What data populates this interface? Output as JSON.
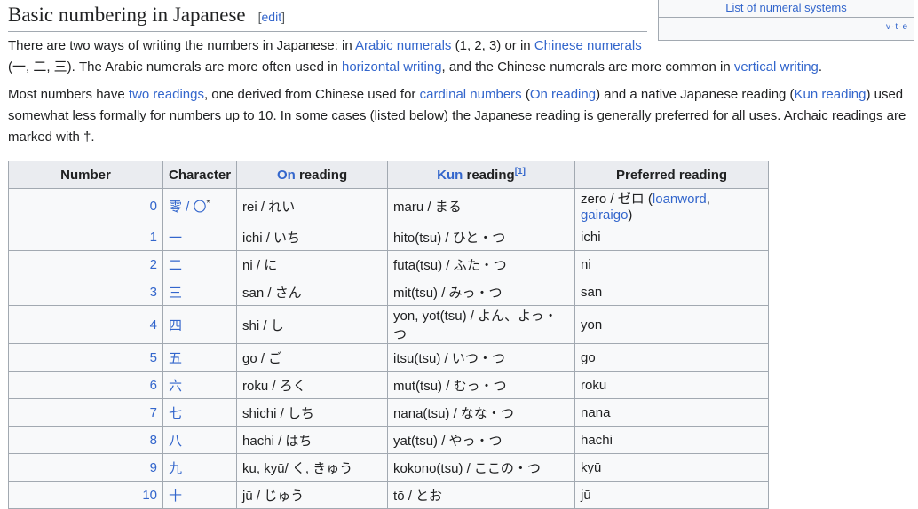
{
  "navbox": {
    "title": "List of numeral systems",
    "vte": "v·t·e"
  },
  "heading": {
    "title": "Basic numbering in Japanese",
    "edit_open": "[",
    "edit_label": "edit",
    "edit_close": "]"
  },
  "p1": {
    "t1": "There are two ways of writing the numbers in Japanese: in ",
    "l1": "Arabic numerals",
    "t2": " (1, 2, 3) or in ",
    "l2": "Chinese numerals",
    "t3": "(一, 二, 三). The Arabic numerals are more often used in ",
    "l3": "horizontal writing",
    "t4": ", and the Chinese numerals are more common in ",
    "l4": "vertical writing",
    "t5": "."
  },
  "p2": {
    "t1": "Most numbers have ",
    "l1": "two readings",
    "t2": ", one derived from Chinese used for ",
    "l2": "cardinal numbers",
    "t3": " (",
    "l3": "On reading",
    "t4": ") and a native Japanese reading (",
    "l4": "Kun reading",
    "t5": ") used somewhat less formally for numbers up to 10. In some cases (listed below) the Japanese reading is generally preferred for all uses. Archaic readings are marked with †."
  },
  "table": {
    "headers": {
      "number": "Number",
      "character": "Character",
      "on_link": "On",
      "on_rest": " reading",
      "kun_link": "Kun",
      "kun_rest": " reading",
      "kun_ref": "[1]",
      "preferred": "Preferred reading"
    },
    "rows": [
      {
        "number": "0",
        "character": "零 / 〇",
        "char_sup": "*",
        "on": "rei / れい",
        "kun": "maru / まる",
        "pref": "zero / ゼロ (",
        "pref_l1": "loanword",
        "pref_sep": ", ",
        "pref_l2": "gairaigo",
        "pref_end": ")"
      },
      {
        "number": "1",
        "character": "一",
        "on": "ichi / いち",
        "kun": "hito(tsu) / ひと・つ",
        "pref": "ichi"
      },
      {
        "number": "2",
        "character": "二",
        "on": "ni / に",
        "kun": "futa(tsu) / ふた・つ",
        "pref": "ni"
      },
      {
        "number": "3",
        "character": "三",
        "on": "san / さん",
        "kun": "mit(tsu) / みっ・つ",
        "pref": "san"
      },
      {
        "number": "4",
        "character": "四",
        "on": "shi / し",
        "kun": "yon, yot(tsu) / よん、よっ・つ",
        "pref": "yon"
      },
      {
        "number": "5",
        "character": "五",
        "on": "go / ご",
        "kun": "itsu(tsu) / いつ・つ",
        "pref": "go"
      },
      {
        "number": "6",
        "character": "六",
        "on": "roku / ろく",
        "kun": "mut(tsu) / むっ・つ",
        "pref": "roku"
      },
      {
        "number": "7",
        "character": "七",
        "on": "shichi / しち",
        "kun": "nana(tsu) / なな・つ",
        "pref": "nana"
      },
      {
        "number": "8",
        "character": "八",
        "on": "hachi / はち",
        "kun": "yat(tsu) / やっ・つ",
        "pref": "hachi"
      },
      {
        "number": "9",
        "character": "九",
        "on": "ku, kyū/ く, きゅう",
        "kun": "kokono(tsu) / ここの・つ",
        "pref": "kyū"
      },
      {
        "number": "10",
        "character": "十",
        "on": "jū / じゅう",
        "kun": "tō / とお",
        "pref": "jū"
      }
    ]
  }
}
